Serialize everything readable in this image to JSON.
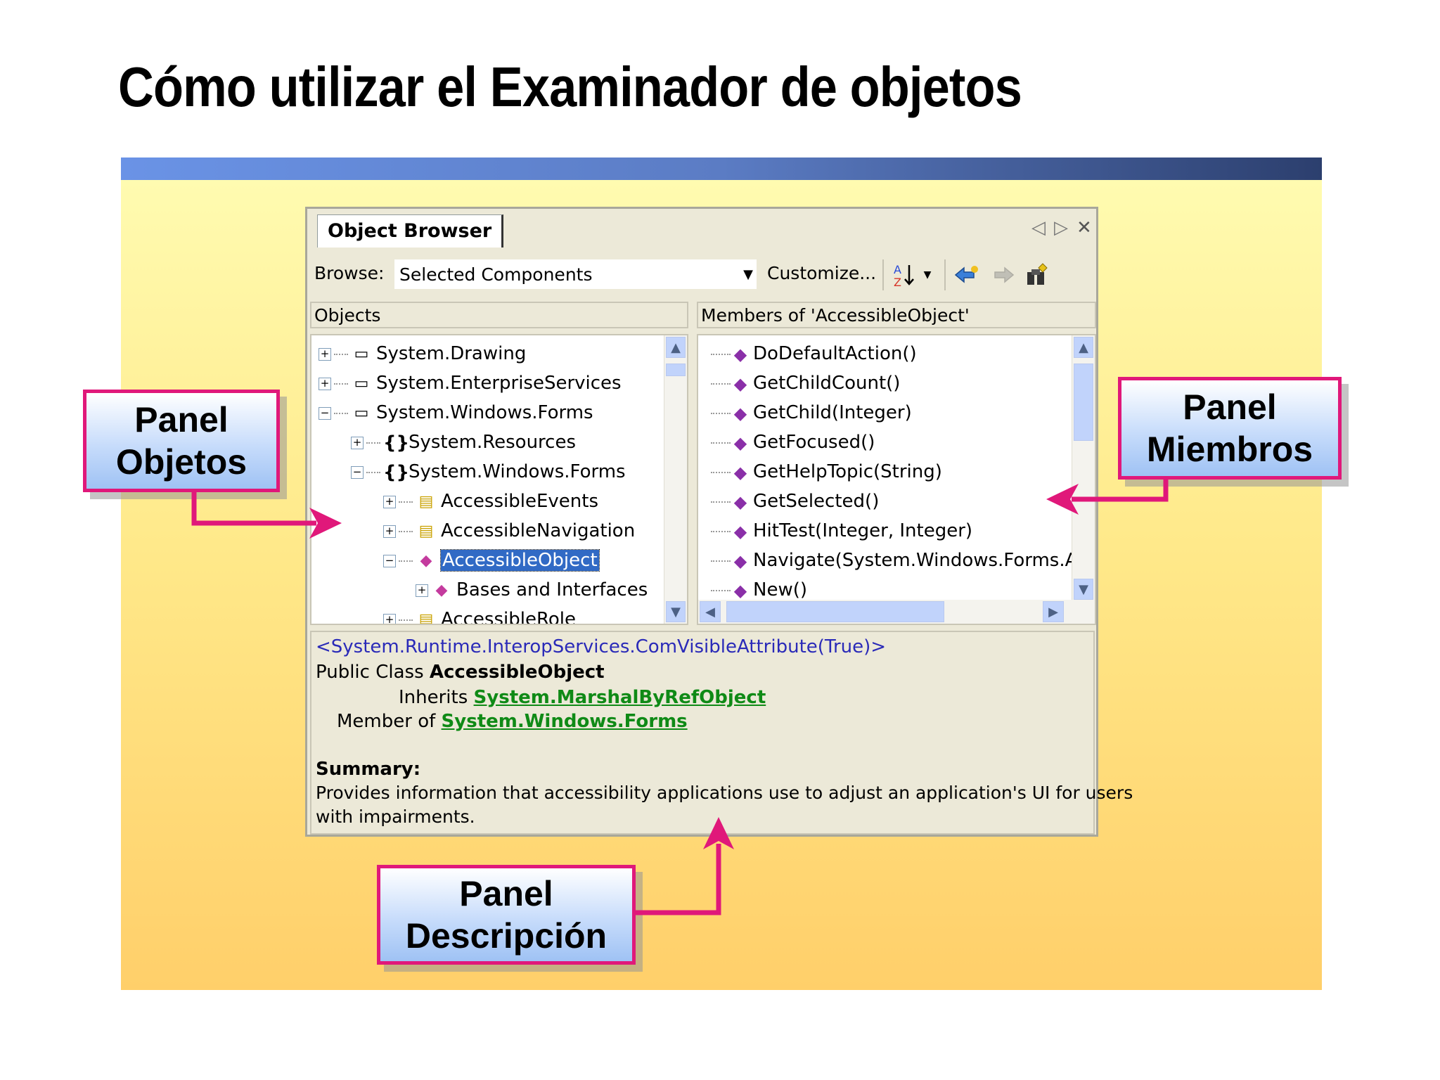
{
  "slide": {
    "title": "Cómo utilizar el Examinador de objetos"
  },
  "window": {
    "tab_title": "Object Browser",
    "controls": {
      "prev": "◁",
      "next": "▷",
      "close": "✕"
    },
    "toolbar": {
      "browse_label": "Browse:",
      "browse_value": "Selected Components",
      "customize_label": "Customize...",
      "icons": [
        "sort-alpha-icon",
        "dropdown-icon",
        "back-icon",
        "forward-icon",
        "find-symbol-icon"
      ]
    },
    "objects_pane": {
      "header": "Objects",
      "items": [
        {
          "label": "System.Drawing",
          "expander": "+",
          "icon": "assembly-icon"
        },
        {
          "label": "System.EnterpriseServices",
          "expander": "+",
          "icon": "assembly-icon"
        },
        {
          "label": "System.Windows.Forms",
          "expander": "−",
          "icon": "assembly-icon"
        },
        {
          "label": "System.Resources",
          "expander": "+",
          "icon": "namespace-icon"
        },
        {
          "label": "System.Windows.Forms",
          "expander": "−",
          "icon": "namespace-icon"
        },
        {
          "label": "AccessibleEvents",
          "expander": "+",
          "icon": "enum-icon"
        },
        {
          "label": "AccessibleNavigation",
          "expander": "+",
          "icon": "enum-icon"
        },
        {
          "label": "AccessibleObject",
          "expander": "−",
          "icon": "class-icon",
          "selected": true
        },
        {
          "label": "Bases and Interfaces",
          "expander": "+",
          "icon": "class-icon"
        },
        {
          "label": "AccessibleRole",
          "expander": "+",
          "icon": "enum-icon"
        }
      ]
    },
    "members_pane": {
      "header": "Members of 'AccessibleObject'",
      "items": [
        "DoDefaultAction()",
        "GetChildCount()",
        "GetChild(Integer)",
        "GetFocused()",
        "GetHelpTopic(String)",
        "GetSelected()",
        "HitTest(Integer, Integer)",
        "Navigate(System.Windows.Forms.Ac",
        "New()"
      ]
    },
    "description_pane": {
      "attribute": "<System.Runtime.InteropServices.ComVisibleAttribute(True)>",
      "class_prefix": "Public Class ",
      "class_name": "AccessibleObject",
      "inherits_label": "Inherits ",
      "inherits_link": "System.MarshalByRefObject",
      "member_of_label": "Member of ",
      "member_of_link": "System.Windows.Forms",
      "summary_label": "Summary:",
      "summary_line1": "Provides information that accessibility applications use to adjust an application's UI for users",
      "summary_line2": "with impairments."
    }
  },
  "callouts": {
    "objects": {
      "line1": "Panel",
      "line2": "Objetos"
    },
    "members": {
      "line1": "Panel",
      "line2": "Miembros"
    },
    "description": {
      "line1": "Panel",
      "line2": "Descripción"
    }
  },
  "colors": {
    "accent": "#e0187a",
    "selection": "#316ac5",
    "link": "#0f8a16",
    "attribute": "#2a2ab8"
  }
}
